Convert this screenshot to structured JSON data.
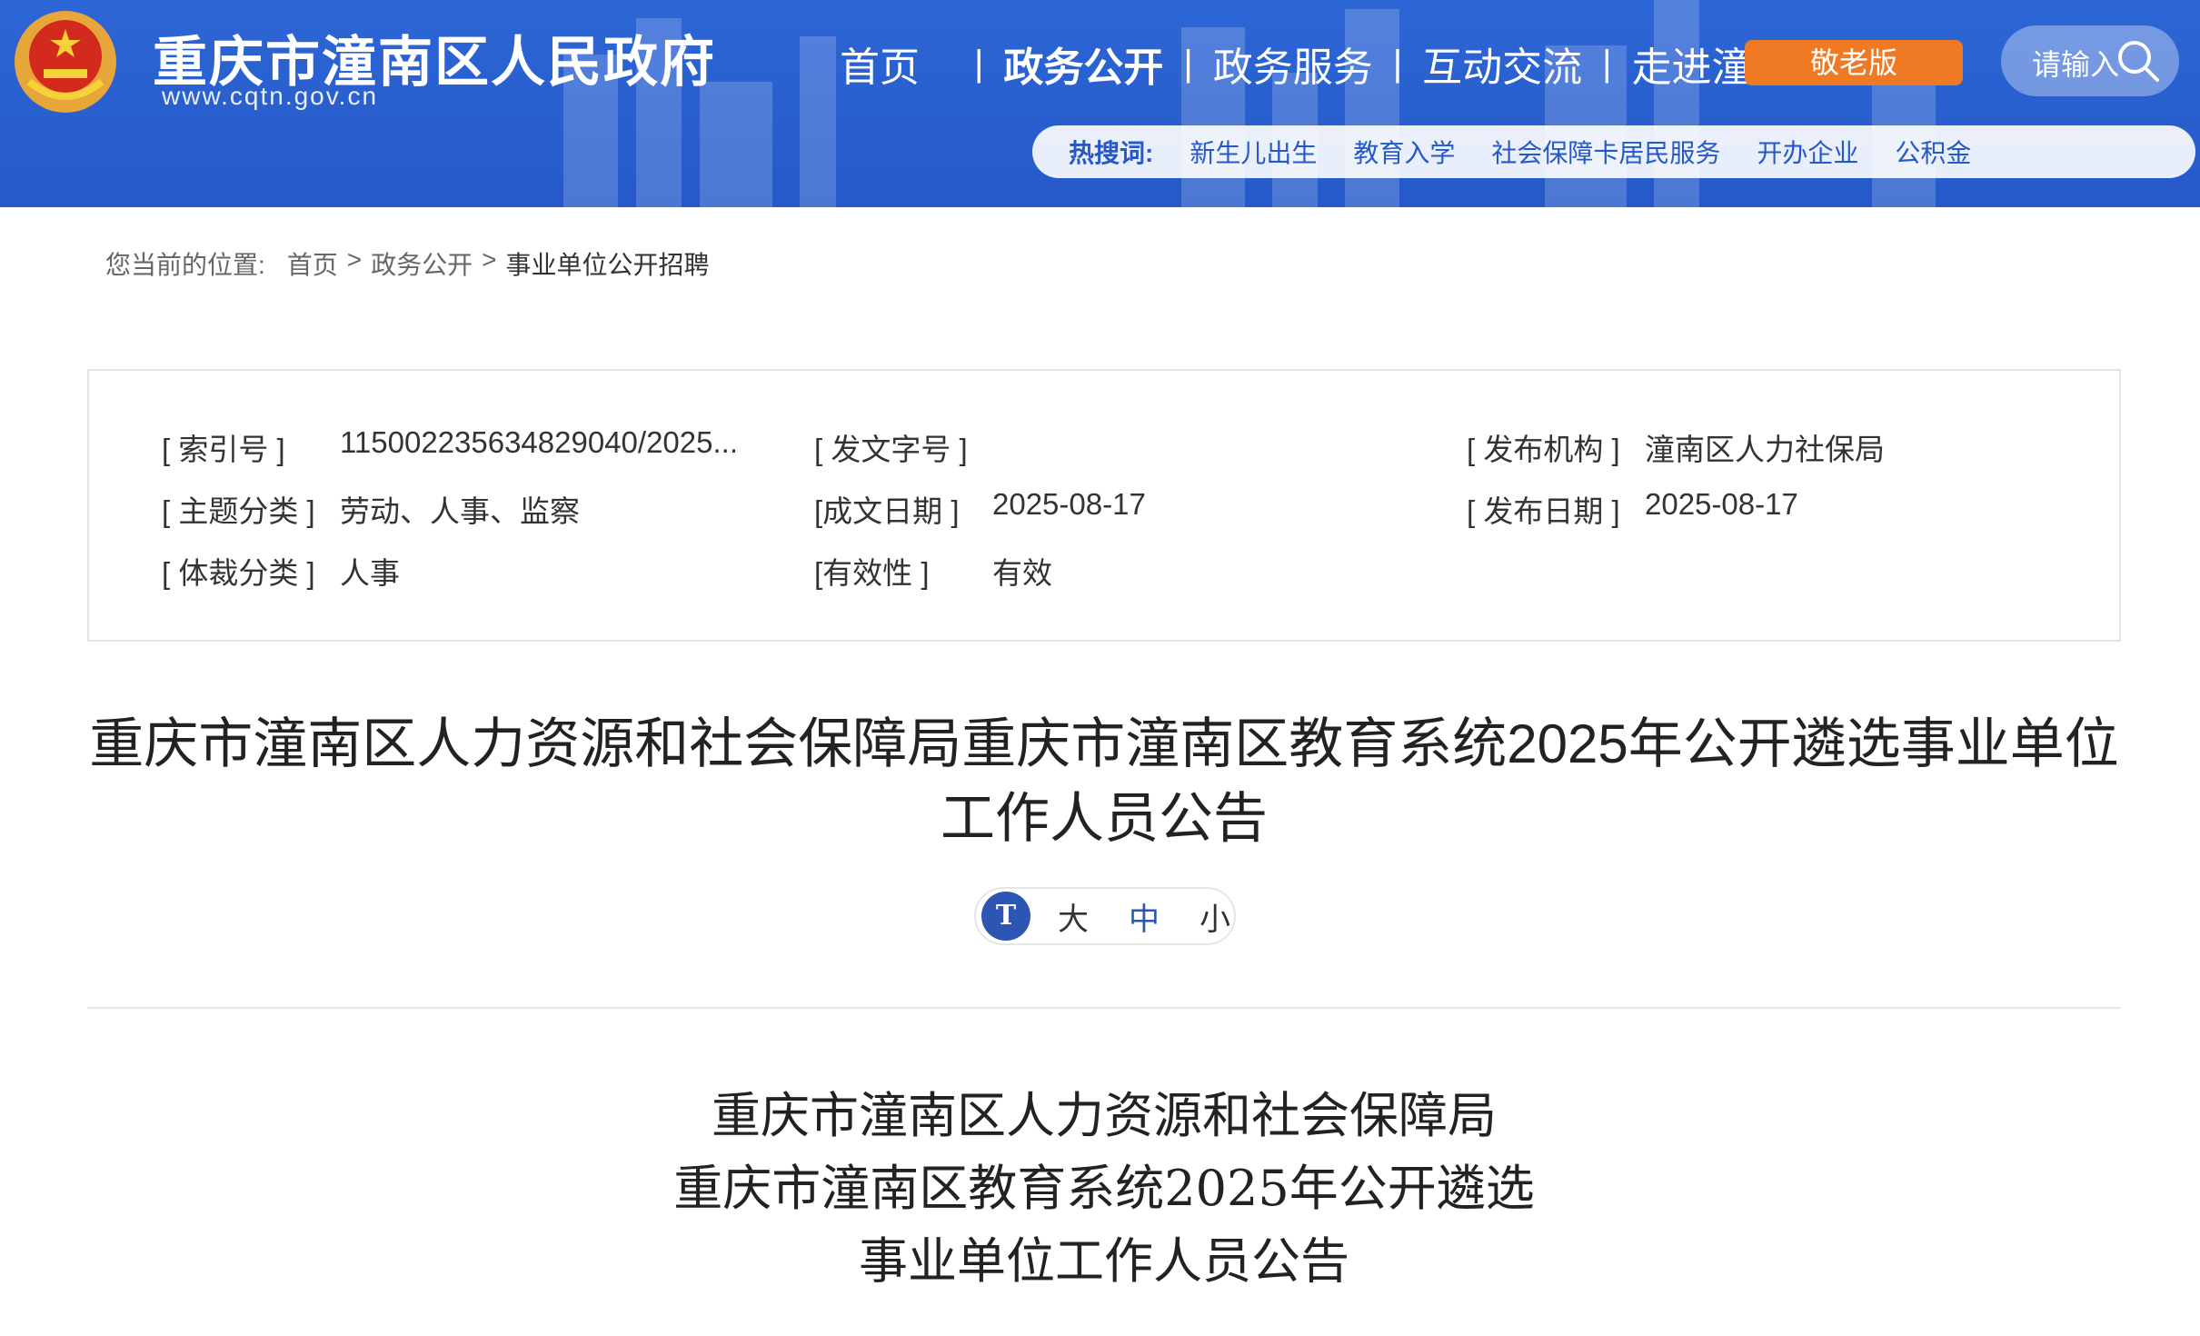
{
  "header": {
    "site_title": "重庆市潼南区人民政府",
    "site_url": "www.cqtn.gov.cn",
    "nav": [
      "首页",
      "政务公开",
      "政务服务",
      "互动交流",
      "走进潼南"
    ],
    "active_nav": "政务公开",
    "elder_label": "敬老版",
    "search_placeholder": "请输入"
  },
  "hot_search": {
    "label": "热搜词:",
    "items": [
      "新生儿出生",
      "教育入学",
      "社会保障卡居民服务",
      "开办企业",
      "公积金"
    ]
  },
  "breadcrumb": {
    "prefix": "您当前的位置:",
    "items": [
      "首页",
      ">",
      "政务公开",
      ">",
      "事业单位公开招聘"
    ]
  },
  "meta": {
    "index_label": "[ 索引号 ]",
    "index_value": "115002235634829040/2025...",
    "doc_no_label": "[ 发文字号 ]",
    "doc_no_value": "",
    "publisher_label": "[ 发布机构 ]",
    "publisher_value": "潼南区人力社保局",
    "topic_label": "[ 主题分类 ]",
    "topic_value": "劳动、人事、监察",
    "written_label": "[成文日期 ]",
    "written_value": "2025-08-17",
    "pub_date_label": "[ 发布日期 ]",
    "pub_date_value": "2025-08-17",
    "genre_label": "[ 体裁分类 ]",
    "genre_value": "人事",
    "valid_label": "[有效性 ]",
    "valid_value": "有效"
  },
  "doc_title_line1": "重庆市潼南区人力资源和社会保障局重庆市潼南区教育系统2025年公开遴选事业单位",
  "doc_title_line2": "工作人员公告",
  "font_size": {
    "large": "大",
    "medium": "中",
    "small": "小",
    "icon": "T"
  },
  "body_title": [
    "重庆市潼南区人力资源和社会保障局",
    "重庆市潼南区教育系统2025年公开遴选",
    "事业单位工作人员公告"
  ],
  "colors": {
    "header_blue": "#2559c9",
    "elder_orange": "#f07a24",
    "accent": "#2d55b3"
  }
}
